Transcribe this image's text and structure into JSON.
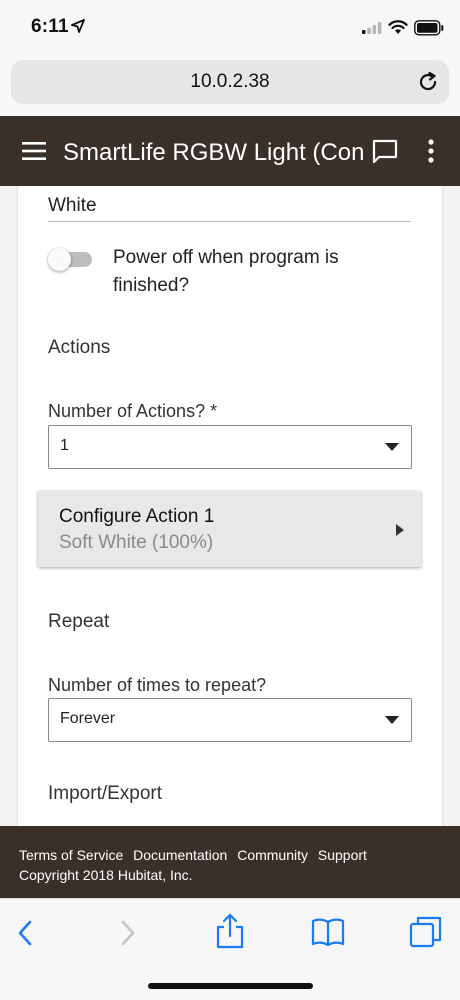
{
  "status_bar": {
    "time": "6:11"
  },
  "browser": {
    "url": "10.0.2.38"
  },
  "header": {
    "title": "SmartLife RGBW Light (Con"
  },
  "form": {
    "top_field_value": "White",
    "power_off_toggle": {
      "label": "Power off when program is finished?",
      "checked": false
    },
    "actions_section_title": "Actions",
    "number_of_actions": {
      "label": "Number of Actions? *",
      "value": "1"
    },
    "configure_action": {
      "title": "Configure Action 1",
      "subtitle": "Soft White (100%)"
    },
    "repeat_section_title": "Repeat",
    "repeat_times": {
      "label": "Number of times to repeat?",
      "value": "Forever"
    },
    "import_export_section_title": "Import/Export"
  },
  "footer": {
    "links": [
      "Terms of Service",
      "Documentation",
      "Community",
      "Support"
    ],
    "copyright": "Copyright 2018 Hubitat, Inc."
  },
  "colors": {
    "header_bg": "#3a302a",
    "ios_tint": "#1a7cf2"
  },
  "icons": {
    "status": [
      "location-arrow-icon",
      "signal-icon",
      "wifi-icon",
      "battery-icon"
    ],
    "address_bar": [
      "reload-icon"
    ],
    "header": [
      "hamburger-menu-icon",
      "chat-icon",
      "more-vertical-icon"
    ],
    "toolbar": [
      "back-icon",
      "forward-icon",
      "share-icon",
      "bookmarks-icon",
      "tabs-icon"
    ]
  }
}
